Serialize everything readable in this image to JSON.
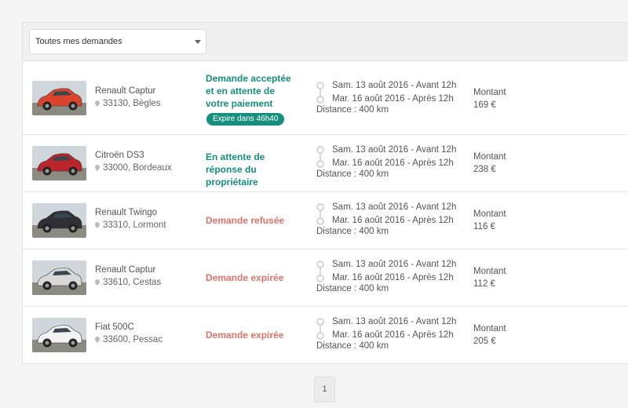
{
  "filter": {
    "selected": "Toutes mes demandes"
  },
  "requests": [
    {
      "car": "Renault Captur",
      "location": "33130, Bègles",
      "status": "Demande acceptée et en attente de votre paiement",
      "status_kind": "ok",
      "badge": "Expire dans 46h40",
      "start": "Sam. 13 août 2016 - Avant 12h",
      "end": "Mar. 16 août 2016 - Après 12h",
      "distance": "Distance : 400 km",
      "amount_label": "Montant",
      "amount": "169 €",
      "car_color": "#d9442b"
    },
    {
      "car": "Citroën DS3",
      "location": "33000, Bordeaux",
      "status": "En attente de réponse du propriétaire",
      "status_kind": "ok",
      "start": "Sam. 13 août 2016 - Avant 12h",
      "end": "Mar. 16 août 2016 - Après 12h",
      "distance": "Distance : 400 km",
      "amount_label": "Montant",
      "amount": "238 €",
      "car_color": "#b8262b"
    },
    {
      "car": "Renault Twingo",
      "location": "33310, Lormont",
      "status": "Demande refusée",
      "status_kind": "bad",
      "start": "Sam. 13 août 2016 - Avant 12h",
      "end": "Mar. 16 août 2016 - Après 12h",
      "distance": "Distance : 400 km",
      "amount_label": "Montant",
      "amount": "116 €",
      "car_color": "#2f2f35"
    },
    {
      "car": "Renault Captur",
      "location": "33610, Cestas",
      "status": "Demande expirée",
      "status_kind": "bad",
      "start": "Sam. 13 août 2016 - Avant 12h",
      "end": "Mar. 16 août 2016 - Après 12h",
      "distance": "Distance : 400 km",
      "amount_label": "Montant",
      "amount": "112 €",
      "car_color": "#d8d8d8"
    },
    {
      "car": "Fiat 500C",
      "location": "33600, Pessac",
      "status": "Demande expirée",
      "status_kind": "bad",
      "start": "Sam. 13 août 2016 - Avant 12h",
      "end": "Mar. 16 août 2016 - Après 12h",
      "distance": "Distance : 400 km",
      "amount_label": "Montant",
      "amount": "205 €",
      "car_color": "#f2f2f2"
    }
  ],
  "pagination": {
    "current": "1"
  },
  "colors": {
    "accent": "#16907d",
    "error": "#e07368"
  }
}
